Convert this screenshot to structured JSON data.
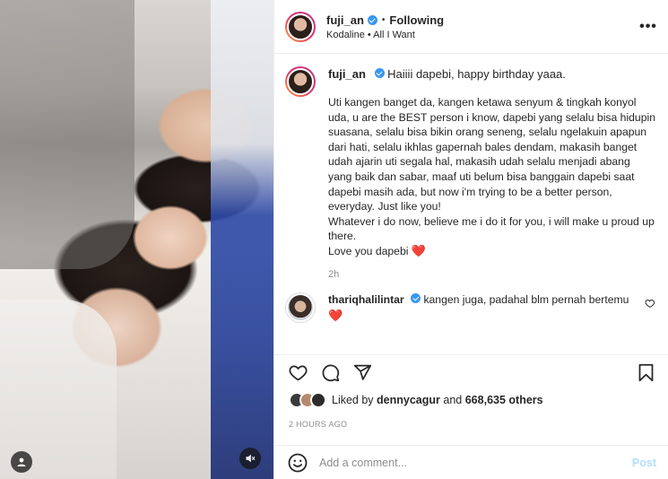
{
  "header": {
    "username": "fuji_an",
    "separator": "•",
    "following_label": "Following",
    "audio": "Kodaline • All I Want",
    "more": "•••"
  },
  "caption": {
    "username": "fuji_an",
    "greeting": "Haiiii dapebi, happy birthday yaaa.",
    "paragraphs": [
      "Uti kangen banget da, kangen ketawa senyum & tingkah konyol uda, u are the BEST person i know, dapebi yang selalu bisa hidupin suasana, selalu bisa bikin orang seneng, selalu ngelakuin apapun dari hati, selalu ikhlas gapernah bales dendam, makasih banget udah ajarin uti segala hal, makasih udah selalu menjadi abang yang baik dan sabar, maaf uti belum bisa banggain dapebi saat dapebi masih ada, but now i'm trying to be a better person, everyday. Just like you!",
      "Whatever i do now, believe me i do it for you, i will make u proud up there."
    ],
    "closing": "Love you dapebi",
    "heart": "❤️",
    "time": "2h"
  },
  "comment": {
    "username": "thariqhalilintar",
    "text": "kangen juga, padahal blm pernah bertemu",
    "heart": "❤️"
  },
  "likes": {
    "prefix": "Liked by",
    "user": "dennycagur",
    "middle": "and",
    "count": "668,635 others"
  },
  "post_time": "2 HOURS AGO",
  "add_comment": {
    "placeholder": "Add a comment...",
    "post_label": "Post"
  },
  "icons": {
    "like": "heart-outline-icon",
    "comment": "speech-bubble-icon",
    "share": "paper-plane-icon",
    "save": "bookmark-icon",
    "emoji": "smiley-icon",
    "user_tag": "user-icon",
    "mute": "muted-speaker-icon"
  },
  "colors": {
    "verified": "#3897f0",
    "heart": "#ed4956",
    "post_disabled": "#b2dffc"
  }
}
